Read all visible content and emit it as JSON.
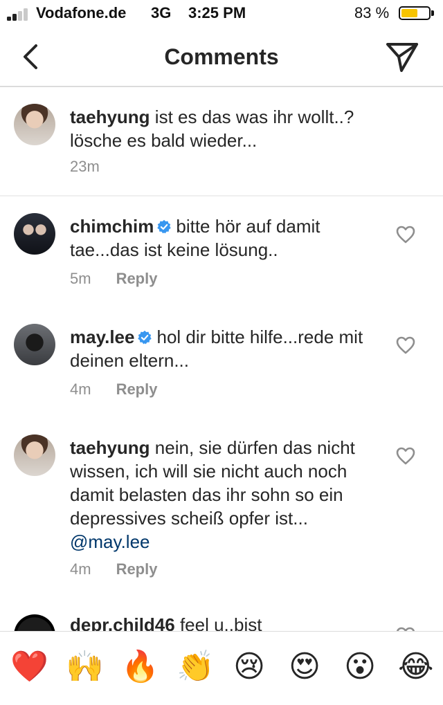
{
  "status_bar": {
    "carrier": "Vodafone.de",
    "network": "3G",
    "time": "3:25 PM",
    "battery_percent": "83 %",
    "battery_level": 0.6,
    "battery_color": "#f6c400"
  },
  "nav": {
    "title": "Comments",
    "back_icon": "chevron-left-icon",
    "send_icon": "direct-send-icon"
  },
  "caption": {
    "username": "taehyung",
    "text": " ist es das was ihr wollt..? lösche es bald wieder...",
    "time": "23m"
  },
  "comments": [
    {
      "username": "chimchim",
      "verified": true,
      "text": "bitte hör auf damit tae...das ist keine lösung..",
      "time": "5m",
      "reply_label": "Reply"
    },
    {
      "username": "may.lee",
      "verified": true,
      "text": "hol dir bitte hilfe...rede mit deinen eltern...",
      "time": "4m",
      "reply_label": "Reply"
    },
    {
      "username": "taehyung",
      "verified": false,
      "text": " nein, sie dürfen das nicht wissen, ich will sie nicht auch noch damit belasten das ihr sohn so ein depressives scheiß opfer ist... ",
      "mention": "@may.lee",
      "time": "4m",
      "reply_label": "Reply"
    },
    {
      "username": "depr.child46",
      "verified": false,
      "text": " feel u..bist"
    }
  ],
  "emoji_bar": [
    "❤️",
    "🙌",
    "🔥",
    "👏",
    "😢",
    "😍",
    "😮",
    "😂"
  ],
  "colors": {
    "verified_badge": "#3897f0",
    "mention": "#00376b",
    "secondary_text": "#8e8e8e"
  }
}
